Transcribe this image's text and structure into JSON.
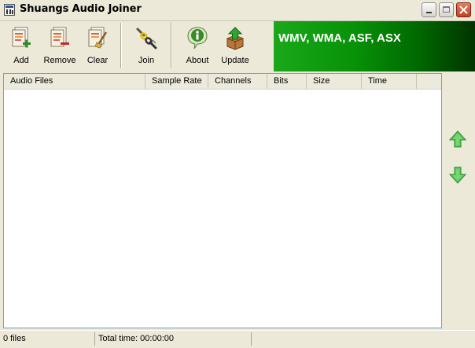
{
  "window": {
    "title": "Shuangs Audio Joiner"
  },
  "toolbar": {
    "buttons": [
      {
        "label": "Add",
        "icon": "add-files-icon"
      },
      {
        "label": "Remove",
        "icon": "remove-files-icon"
      },
      {
        "label": "Clear",
        "icon": "clear-list-icon"
      },
      {
        "label": "Join",
        "icon": "join-chain-icon"
      },
      {
        "label": "About",
        "icon": "info-icon"
      },
      {
        "label": "Update",
        "icon": "update-box-icon"
      }
    ]
  },
  "banner": {
    "text": "WMV, WMA, ASF, ASX",
    "colors": [
      "#1aa81a",
      "#003400"
    ]
  },
  "list": {
    "columns": [
      "Audio Files",
      "Sample Rate",
      "Channels",
      "Bits",
      "Size",
      "Time"
    ],
    "rows": []
  },
  "side_buttons": [
    {
      "icon": "move-up-arrow-icon",
      "color": "#3cb83c"
    },
    {
      "icon": "move-down-arrow-icon",
      "color": "#3cb83c"
    }
  ],
  "status": {
    "file_count": "0 files",
    "total_time": "Total time: 00:00:00"
  }
}
